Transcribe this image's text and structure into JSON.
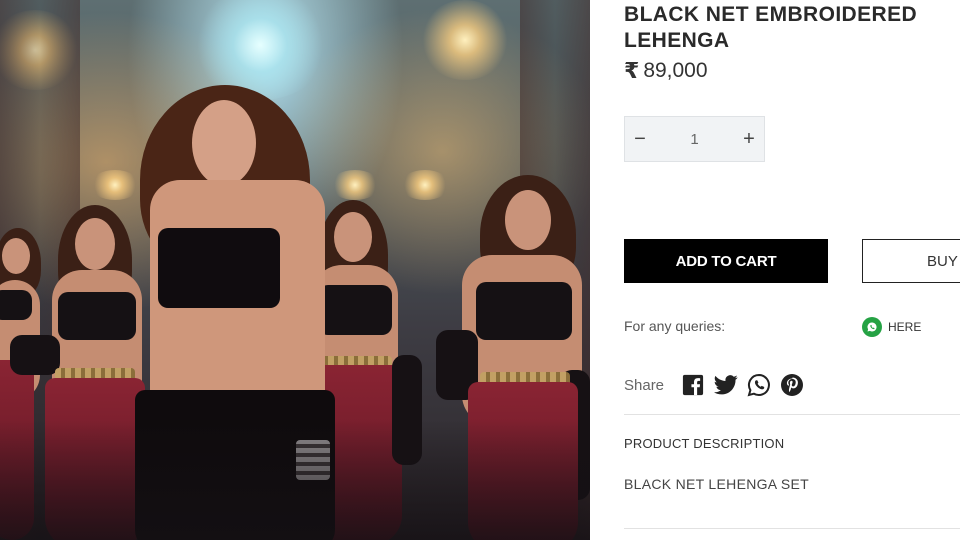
{
  "product": {
    "title": "BLACK NET EMBROIDERED LEHENGA",
    "currency_symbol": "₹",
    "price": "89,000",
    "image_alt_icon": "product-photo"
  },
  "quantity": {
    "decrement_label": "−",
    "value": "1",
    "increment_label": "+"
  },
  "actions": {
    "add_to_cart_label": "ADD TO CART",
    "buy_label": "BUY"
  },
  "queries": {
    "label": "For any queries:",
    "whatsapp_label": "HERE",
    "whatsapp_icon": "whatsapp-icon"
  },
  "share": {
    "label": "Share",
    "icons": [
      "facebook-icon",
      "twitter-icon",
      "whatsapp-icon",
      "pinterest-icon"
    ]
  },
  "description": {
    "heading": "PRODUCT DESCRIPTION",
    "text": "BLACK NET LEHENGA SET"
  },
  "colors": {
    "primary_button": "#000000",
    "whatsapp_green": "#25a244",
    "divider": "#e2e2e2"
  }
}
